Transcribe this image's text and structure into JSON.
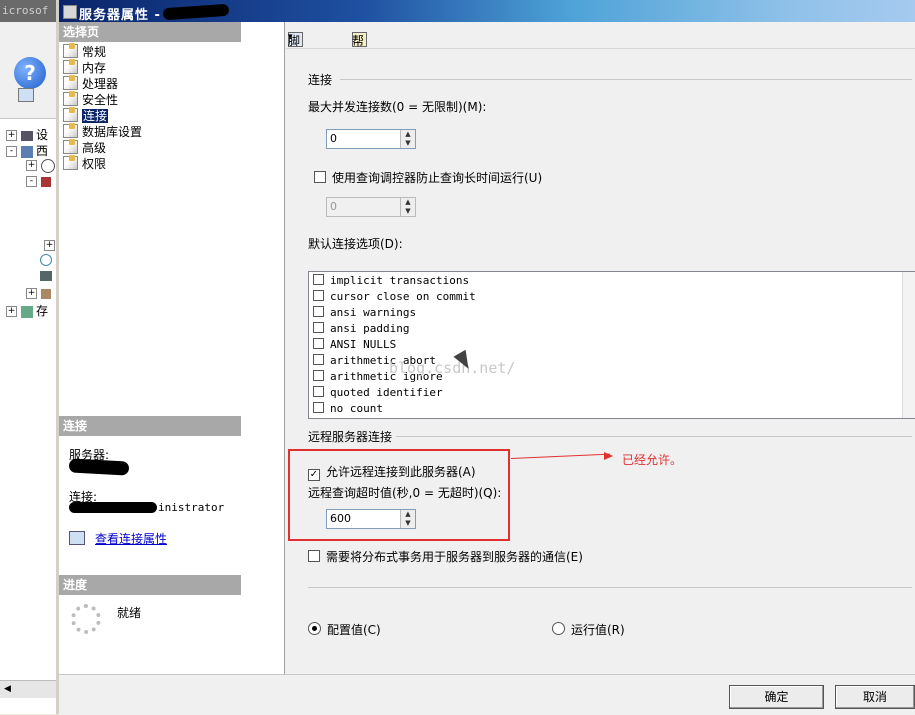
{
  "background_app": {
    "title_fragment": "icrosof",
    "tree_rows": [
      {
        "expander": "+",
        "label": "设"
      },
      {
        "expander": "-",
        "label": "西"
      },
      {
        "expander": "+",
        "label": ""
      },
      {
        "expander": "-",
        "label": ""
      },
      {
        "expander": "+",
        "label": "存"
      }
    ]
  },
  "dialog": {
    "title": "服务器属性 - C",
    "left": {
      "select_page_header": "选择页",
      "pages": [
        "常规",
        "内存",
        "处理器",
        "安全性",
        "连接",
        "数据库设置",
        "高级",
        "权限"
      ],
      "selected_page": "连接",
      "connection_header": "连接",
      "server_label": "服务器:",
      "connection_label": "连接:",
      "connection_value_suffix": "inistrator",
      "view_connection_link": "查看连接属性",
      "progress_header": "进度",
      "progress_status": "就绪"
    },
    "toolbar": {
      "script_label": "脚本",
      "help_label": "帮助"
    },
    "connections": {
      "section_title": "连接",
      "max_concurrent_label": "最大并发连接数(0 = 无限制)(M):",
      "max_concurrent_value": "0",
      "query_governor_label": "使用查询调控器防止查询长时间运行(U)",
      "query_governor_checked": false,
      "query_governor_value": "0",
      "default_options_label": "默认连接选项(D):",
      "default_options": [
        "implicit transactions",
        "cursor close on commit",
        "ansi warnings",
        "ansi padding",
        "ANSI NULLS",
        "arithmetic abort",
        "arithmetic ignore",
        "quoted identifier",
        "no count"
      ]
    },
    "remote": {
      "section_title": "远程服务器连接",
      "allow_remote_label": "允许远程连接到此服务器(A)",
      "allow_remote_checked": true,
      "timeout_label": "远程查询超时值(秒,0 = 无超时)(Q):",
      "timeout_value": "600",
      "distributed_tx_label": "需要将分布式事务用于服务器到服务器的通信(E)",
      "distributed_tx_checked": false
    },
    "annotation_text": "已经允许。",
    "watermark": "blog.csdn.net/",
    "radio_configured": "配置值(C)",
    "radio_running": "运行值(R)",
    "radio_selected": "configured",
    "ok_label": "确定",
    "cancel_label": "取消"
  }
}
